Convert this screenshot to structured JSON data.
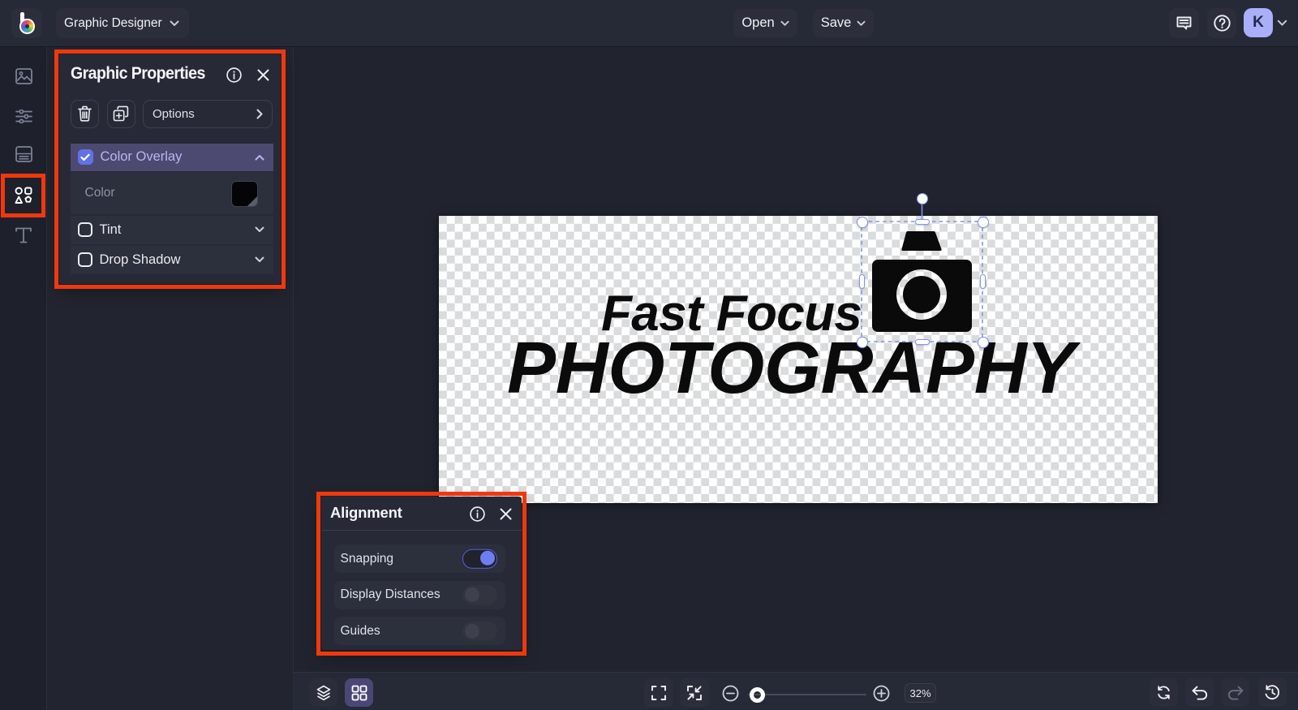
{
  "topbar": {
    "mode_label": "Graphic Designer",
    "open_label": "Open",
    "save_label": "Save",
    "avatar_initial": "K"
  },
  "sidebar": {
    "items": [
      {
        "id": "image-manager",
        "icon": "image-icon",
        "active": false
      },
      {
        "id": "edit",
        "icon": "sliders-icon",
        "active": false
      },
      {
        "id": "templates",
        "icon": "layout-icon",
        "active": false
      },
      {
        "id": "graphics",
        "icon": "shapes-icon",
        "active": true,
        "annotated": true
      },
      {
        "id": "text",
        "icon": "text-icon",
        "active": false
      }
    ]
  },
  "graphic_properties": {
    "title": "Graphic Properties",
    "options_label": "Options",
    "color_overlay_label": "Color Overlay",
    "color_overlay_checked": true,
    "color_label": "Color",
    "color_value": "#000000",
    "tint_label": "Tint",
    "tint_checked": false,
    "drop_shadow_label": "Drop Shadow",
    "drop_shadow_checked": false
  },
  "alignment": {
    "title": "Alignment",
    "rows": {
      "snapping": {
        "label": "Snapping",
        "on": true
      },
      "display_distances": {
        "label": "Display Distances",
        "on": false
      },
      "guides": {
        "label": "Guides",
        "on": false
      }
    }
  },
  "canvas": {
    "logo_line1": "Fast Focus",
    "logo_line2": "PHOTOGRAPHY"
  },
  "toolbar": {
    "zoom_percent": "32%"
  },
  "colors": {
    "annotation": "#f0380f",
    "accent_indigo": "#6172e6",
    "toggle_on": "#6f7df2",
    "avatar_bg": "#a9aff8",
    "panel_bg": "#272a36",
    "checker_gray": "#dadbdd"
  }
}
